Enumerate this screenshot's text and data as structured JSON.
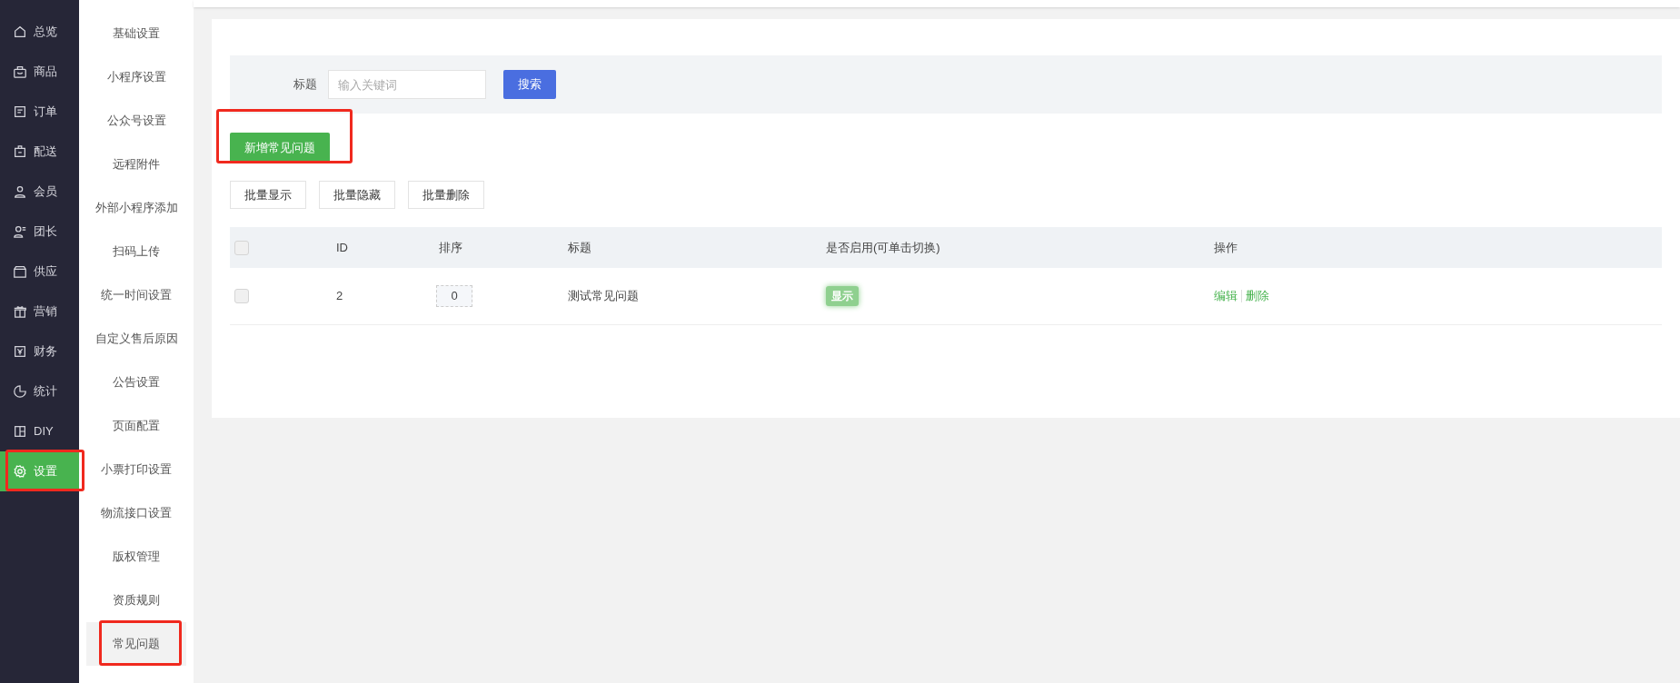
{
  "nav": [
    {
      "label": "总览",
      "selected": false,
      "highlighted": false
    },
    {
      "label": "商品",
      "selected": false,
      "highlighted": false
    },
    {
      "label": "订单",
      "selected": false,
      "highlighted": false
    },
    {
      "label": "配送",
      "selected": false,
      "highlighted": false
    },
    {
      "label": "会员",
      "selected": false,
      "highlighted": false
    },
    {
      "label": "团长",
      "selected": false,
      "highlighted": false
    },
    {
      "label": "供应",
      "selected": false,
      "highlighted": false
    },
    {
      "label": "营销",
      "selected": false,
      "highlighted": false
    },
    {
      "label": "财务",
      "selected": false,
      "highlighted": false
    },
    {
      "label": "统计",
      "selected": false,
      "highlighted": false
    },
    {
      "label": "DIY",
      "selected": false,
      "highlighted": false
    },
    {
      "label": "设置",
      "selected": true,
      "highlighted": true
    }
  ],
  "subnav": [
    {
      "label": "基础设置",
      "selected": false,
      "highlighted": false
    },
    {
      "label": "小程序设置",
      "selected": false,
      "highlighted": false
    },
    {
      "label": "公众号设置",
      "selected": false,
      "highlighted": false
    },
    {
      "label": "远程附件",
      "selected": false,
      "highlighted": false
    },
    {
      "label": "外部小程序添加",
      "selected": false,
      "highlighted": false
    },
    {
      "label": "扫码上传",
      "selected": false,
      "highlighted": false
    },
    {
      "label": "统一时间设置",
      "selected": false,
      "highlighted": false
    },
    {
      "label": "自定义售后原因",
      "selected": false,
      "highlighted": false
    },
    {
      "label": "公告设置",
      "selected": false,
      "highlighted": false
    },
    {
      "label": "页面配置",
      "selected": false,
      "highlighted": false
    },
    {
      "label": "小票打印设置",
      "selected": false,
      "highlighted": false
    },
    {
      "label": "物流接口设置",
      "selected": false,
      "highlighted": false
    },
    {
      "label": "版权管理",
      "selected": false,
      "highlighted": false
    },
    {
      "label": "资质规则",
      "selected": false,
      "highlighted": false
    },
    {
      "label": "常见问题",
      "selected": true,
      "highlighted": true
    }
  ],
  "search": {
    "label": "标题",
    "placeholder": "输入关键词",
    "button": "搜索"
  },
  "add_button": {
    "label": "新增常见问题",
    "highlighted": true
  },
  "batch_buttons": [
    "批量显示",
    "批量隐藏",
    "批量删除"
  ],
  "table": {
    "columns": [
      "ID",
      "排序",
      "标题",
      "是否启用(可单击切换)",
      "操作"
    ],
    "rows": [
      {
        "checked": false,
        "id": "2",
        "sort": "0",
        "title": "测试常见问题",
        "status": "显示",
        "enabled": true,
        "actions": [
          "编辑",
          "删除"
        ]
      }
    ],
    "all_checked": false
  }
}
